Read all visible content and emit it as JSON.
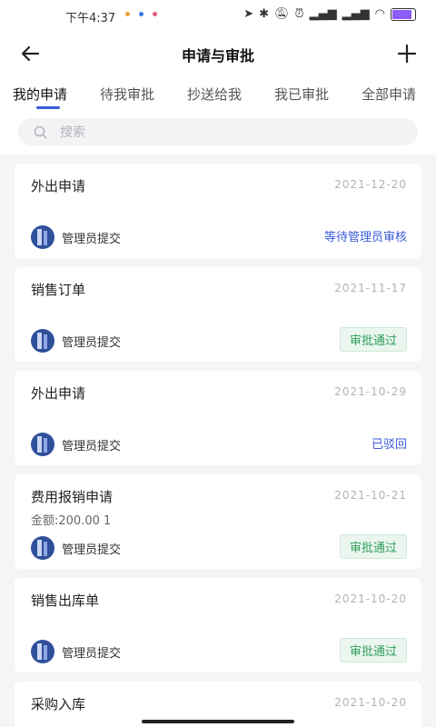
{
  "status_bar": {
    "time": "下午4:37"
  },
  "header": {
    "title": "申请与审批"
  },
  "tabs": [
    {
      "label": "我的申请",
      "active": true
    },
    {
      "label": "待我审批",
      "active": false
    },
    {
      "label": "抄送给我",
      "active": false
    },
    {
      "label": "我已审批",
      "active": false
    },
    {
      "label": "全部申请",
      "active": false
    }
  ],
  "search": {
    "placeholder": "搜索"
  },
  "cards": [
    {
      "title": "外出申请",
      "date": "2021-12-20",
      "submitter": "管理员提交",
      "status": "等待管理员审核",
      "status_type": "pending"
    },
    {
      "title": "销售订单",
      "date": "2021-11-17",
      "submitter": "管理员提交",
      "status": "审批通过",
      "status_type": "approved"
    },
    {
      "title": "外出申请",
      "date": "2021-10-29",
      "submitter": "管理员提交",
      "status": "已驳回",
      "status_type": "rejected"
    },
    {
      "title": "费用报销申请",
      "date": "2021-10-21",
      "amount": "金额:200.00  1",
      "submitter": "管理员提交",
      "status": "审批通过",
      "status_type": "approved"
    },
    {
      "title": "销售出库单",
      "date": "2021-10-20",
      "submitter": "管理员提交",
      "status": "审批通过",
      "status_type": "approved"
    },
    {
      "title": "采购入库",
      "date": "2021-10-20"
    }
  ],
  "colors": {
    "accent": "#3a5bd9",
    "approved": "#2f9e5a",
    "background": "#f4f5f7"
  },
  "icons": [
    "back-arrow-icon",
    "plus-icon",
    "search-icon",
    "location-icon",
    "bluetooth-icon",
    "mute-icon",
    "alarm-icon",
    "signal-icon",
    "wifi-icon",
    "battery-icon"
  ]
}
